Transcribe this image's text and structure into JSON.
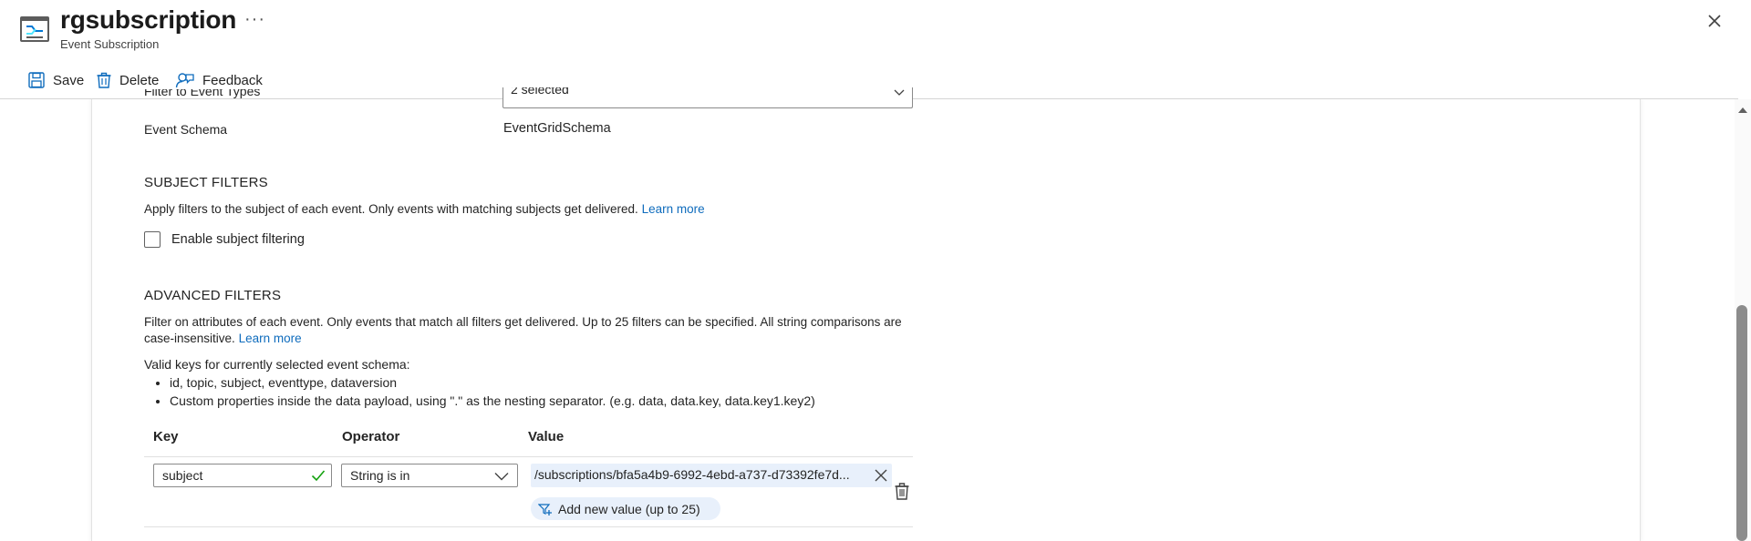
{
  "header": {
    "title": "rgsubscription",
    "subtitle": "Event Subscription",
    "more_label": "···"
  },
  "toolbar": {
    "save_label": "Save",
    "delete_label": "Delete",
    "feedback_label": "Feedback"
  },
  "filters": {
    "event_types_label": "Filter to Event Types",
    "event_types_value": "2 selected",
    "event_schema_label": "Event Schema",
    "event_schema_value": "EventGridSchema"
  },
  "subject_filters": {
    "title": "SUBJECT FILTERS",
    "description": "Apply filters to the subject of each event. Only events with matching subjects get delivered.",
    "learn_more": "Learn more",
    "checkbox_label": "Enable subject filtering",
    "checked": false
  },
  "advanced_filters": {
    "title": "ADVANCED FILTERS",
    "description_line1": "Filter on attributes of each event. Only events that match all filters get delivered. Up to 25 filters can be specified. All string comparisons are",
    "description_line2": "case-insensitive.",
    "learn_more": "Learn more",
    "valid_keys_intro": "Valid keys for currently selected event schema:",
    "valid_keys": [
      "id, topic, subject, eventtype, dataversion",
      "Custom properties inside the data payload, using \".\" as the nesting separator. (e.g. data, data.key, data.key1.key2)"
    ],
    "columns": {
      "key": "Key",
      "operator": "Operator",
      "value": "Value"
    },
    "rows": [
      {
        "key": "subject",
        "operator": "String is in",
        "value": "/subscriptions/bfa5a4b9-6992-4ebd-a737-d73392fe7d...",
        "add_value_label": "Add new value (up to 25)"
      }
    ]
  },
  "colors": {
    "accent": "#0f6cbd",
    "valid_check": "#13a10e",
    "chip_bg": "#e8f0fb"
  }
}
